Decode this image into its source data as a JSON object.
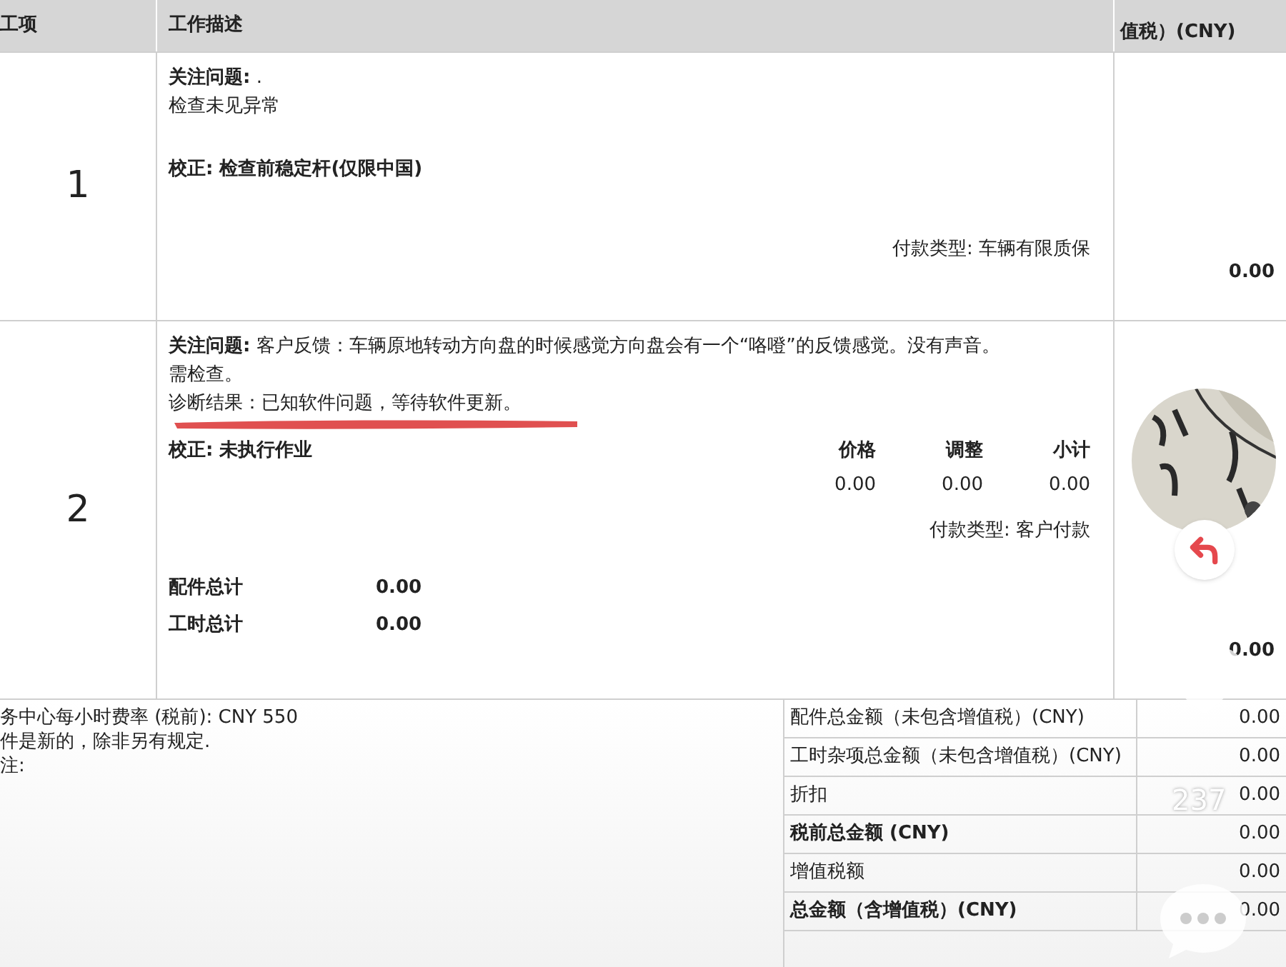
{
  "table": {
    "columns": [
      "工项",
      "工作描述",
      "值税）(CNY)"
    ],
    "rows": [
      {
        "number": "1",
        "lines": [
          {
            "kind": "text",
            "text": "**关注问题:** ."
          },
          {
            "kind": "text",
            "text": "检查未见异常"
          }
        ],
        "correction": "校正: 检查前稳定杆(仅限中国)",
        "payment": "付款类型: 车辆有限质保",
        "amount": "0.00"
      },
      {
        "number": "2",
        "lines": [
          {
            "kind": "text",
            "text": "**关注问题:** 客户反馈：车辆原地转动方向盘的时候感觉方向盘会有一个“咯噔”的反馈感觉。没有声音。需检查。"
          },
          {
            "kind": "underlined",
            "text": "诊断结果：已知软件问题，等待软件更新。"
          }
        ],
        "correction": "校正: 未执行作业",
        "price_headers": [
          "价格",
          "调整",
          "小计"
        ],
        "price_values": [
          "0.00",
          "0.00",
          "0.00"
        ],
        "payment": "付款类型: 客户付款",
        "totals": [
          {
            "label": "配件总计",
            "value": "0.00"
          },
          {
            "label": "工时总计",
            "value": "0.00"
          }
        ],
        "amount": "0.00"
      }
    ]
  },
  "notes": [
    "务中心每小时费率 (税前): CNY 550",
    "件是新的，除非另有规定.",
    "注:"
  ],
  "summary": [
    {
      "label": "配件总金额（未包含增值税）(CNY)",
      "value": "0.00",
      "bold": false
    },
    {
      "label": "工时杂项总金额（未包含增值税）(CNY)",
      "value": "0.00",
      "bold": false
    },
    {
      "label": "折扣",
      "value": "0.00",
      "bold": false
    },
    {
      "label": "税前总金额 (CNY)",
      "value": "0.00",
      "bold": true
    },
    {
      "label": "增值税额",
      "value": "0.00",
      "bold": false
    },
    {
      "label": "总金额（含增值税）(CNY)",
      "value": "0.00",
      "bold": true
    }
  ],
  "overlay": {
    "like_count": "237"
  }
}
